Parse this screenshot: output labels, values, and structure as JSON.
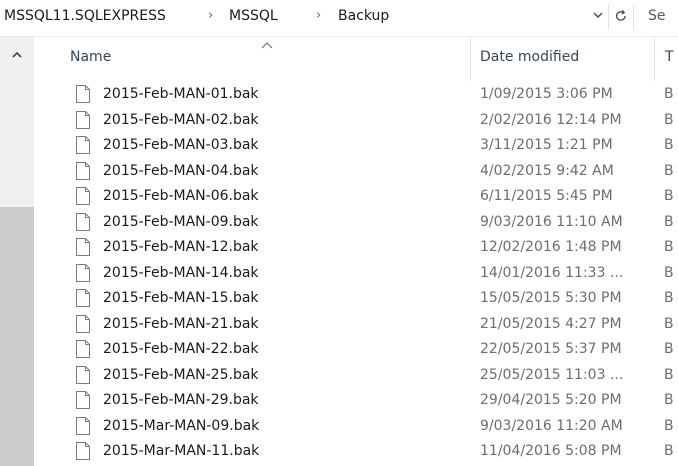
{
  "breadcrumb": {
    "items": [
      "MSSQL11.SQLEXPRESS",
      "MSSQL",
      "Backup"
    ],
    "separator": "›"
  },
  "search": {
    "placeholder_visible": "Se"
  },
  "columns": {
    "name": "Name",
    "date_modified": "Date modified",
    "type_partial": "T"
  },
  "files": [
    {
      "name": "2015-Feb-MAN-01.bak",
      "date": "1/09/2015 3:06 PM",
      "type": "B"
    },
    {
      "name": "2015-Feb-MAN-02.bak",
      "date": "2/02/2016 12:14 PM",
      "type": "B"
    },
    {
      "name": "2015-Feb-MAN-03.bak",
      "date": "3/11/2015 1:21 PM",
      "type": "B"
    },
    {
      "name": "2015-Feb-MAN-04.bak",
      "date": "4/02/2015 9:42 AM",
      "type": "B"
    },
    {
      "name": "2015-Feb-MAN-06.bak",
      "date": "6/11/2015 5:45 PM",
      "type": "B"
    },
    {
      "name": "2015-Feb-MAN-09.bak",
      "date": "9/03/2016 11:10 AM",
      "type": "B"
    },
    {
      "name": "2015-Feb-MAN-12.bak",
      "date": "12/02/2016 1:48 PM",
      "type": "B"
    },
    {
      "name": "2015-Feb-MAN-14.bak",
      "date": "14/01/2016 11:33 ...",
      "type": "B"
    },
    {
      "name": "2015-Feb-MAN-15.bak",
      "date": "15/05/2015 5:30 PM",
      "type": "B"
    },
    {
      "name": "2015-Feb-MAN-21.bak",
      "date": "21/05/2015 4:27 PM",
      "type": "B"
    },
    {
      "name": "2015-Feb-MAN-22.bak",
      "date": "22/05/2015 5:37 PM",
      "type": "B"
    },
    {
      "name": "2015-Feb-MAN-25.bak",
      "date": "25/05/2015 11:03 ...",
      "type": "B"
    },
    {
      "name": "2015-Feb-MAN-29.bak",
      "date": "29/04/2015 5:20 PM",
      "type": "B"
    },
    {
      "name": "2015-Mar-MAN-09.bak",
      "date": "9/03/2016 11:20 AM",
      "type": "B"
    },
    {
      "name": "2015-Mar-MAN-11.bak",
      "date": "11/04/2016 5:08 PM",
      "type": "B"
    }
  ],
  "icons": {
    "file": "file-icon",
    "refresh": "refresh-icon",
    "dropdown": "chevron-down-icon",
    "scroll_up": "scroll-up-icon",
    "sort": "sort-ascending-icon"
  },
  "colors": {
    "header_text": "#33475b",
    "date_text": "#6d6d6d",
    "rail_bg": "#f0f0f0",
    "rail_thumb": "#cdcdcd"
  }
}
